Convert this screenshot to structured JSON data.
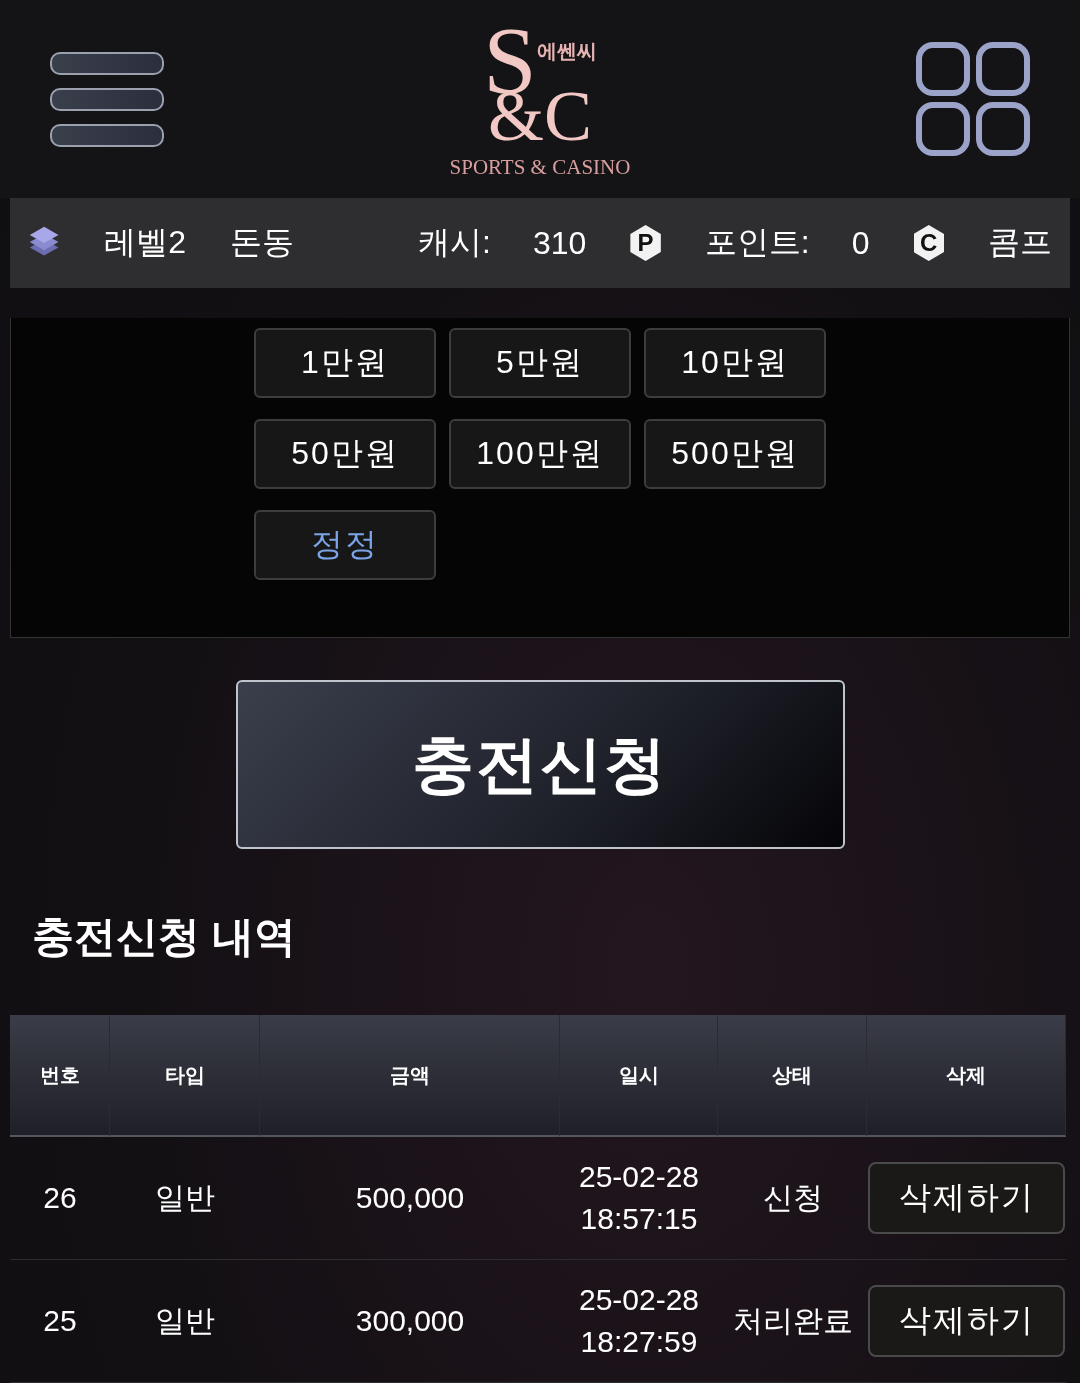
{
  "header": {
    "logo": {
      "letter_s": "S",
      "letters_c": "&C",
      "korean_name": "에쎈씨",
      "tagline": "SPORTS & CASINO"
    }
  },
  "user_bar": {
    "level": "레벨2",
    "name": "돈동",
    "cash_label": "캐시:",
    "cash": "310",
    "point_badge": "P",
    "point_label": "포인트:",
    "points": "0",
    "comp_badge": "C",
    "comp_label": "콤프"
  },
  "amount_buttons": [
    {
      "label": "1만원",
      "kind": "amount"
    },
    {
      "label": "5만원",
      "kind": "amount"
    },
    {
      "label": "10만원",
      "kind": "amount"
    },
    {
      "label": "50만원",
      "kind": "amount"
    },
    {
      "label": "100만원",
      "kind": "amount"
    },
    {
      "label": "500만원",
      "kind": "amount"
    },
    {
      "label": "정정",
      "kind": "reset"
    }
  ],
  "submit_button": "충전신청",
  "history": {
    "title": "충전신청 내역",
    "columns": [
      "번호",
      "타입",
      "금액",
      "일시",
      "상태",
      "삭제"
    ],
    "rows": [
      {
        "number": "26",
        "type": "일반",
        "amount": "500,000",
        "date": "25-02-28",
        "time": "18:57:15",
        "status": "신청",
        "action": "삭제하기"
      },
      {
        "number": "25",
        "type": "일반",
        "amount": "300,000",
        "date": "25-02-28",
        "time": "18:27:59",
        "status": "처리완료",
        "action": "삭제하기"
      }
    ]
  }
}
